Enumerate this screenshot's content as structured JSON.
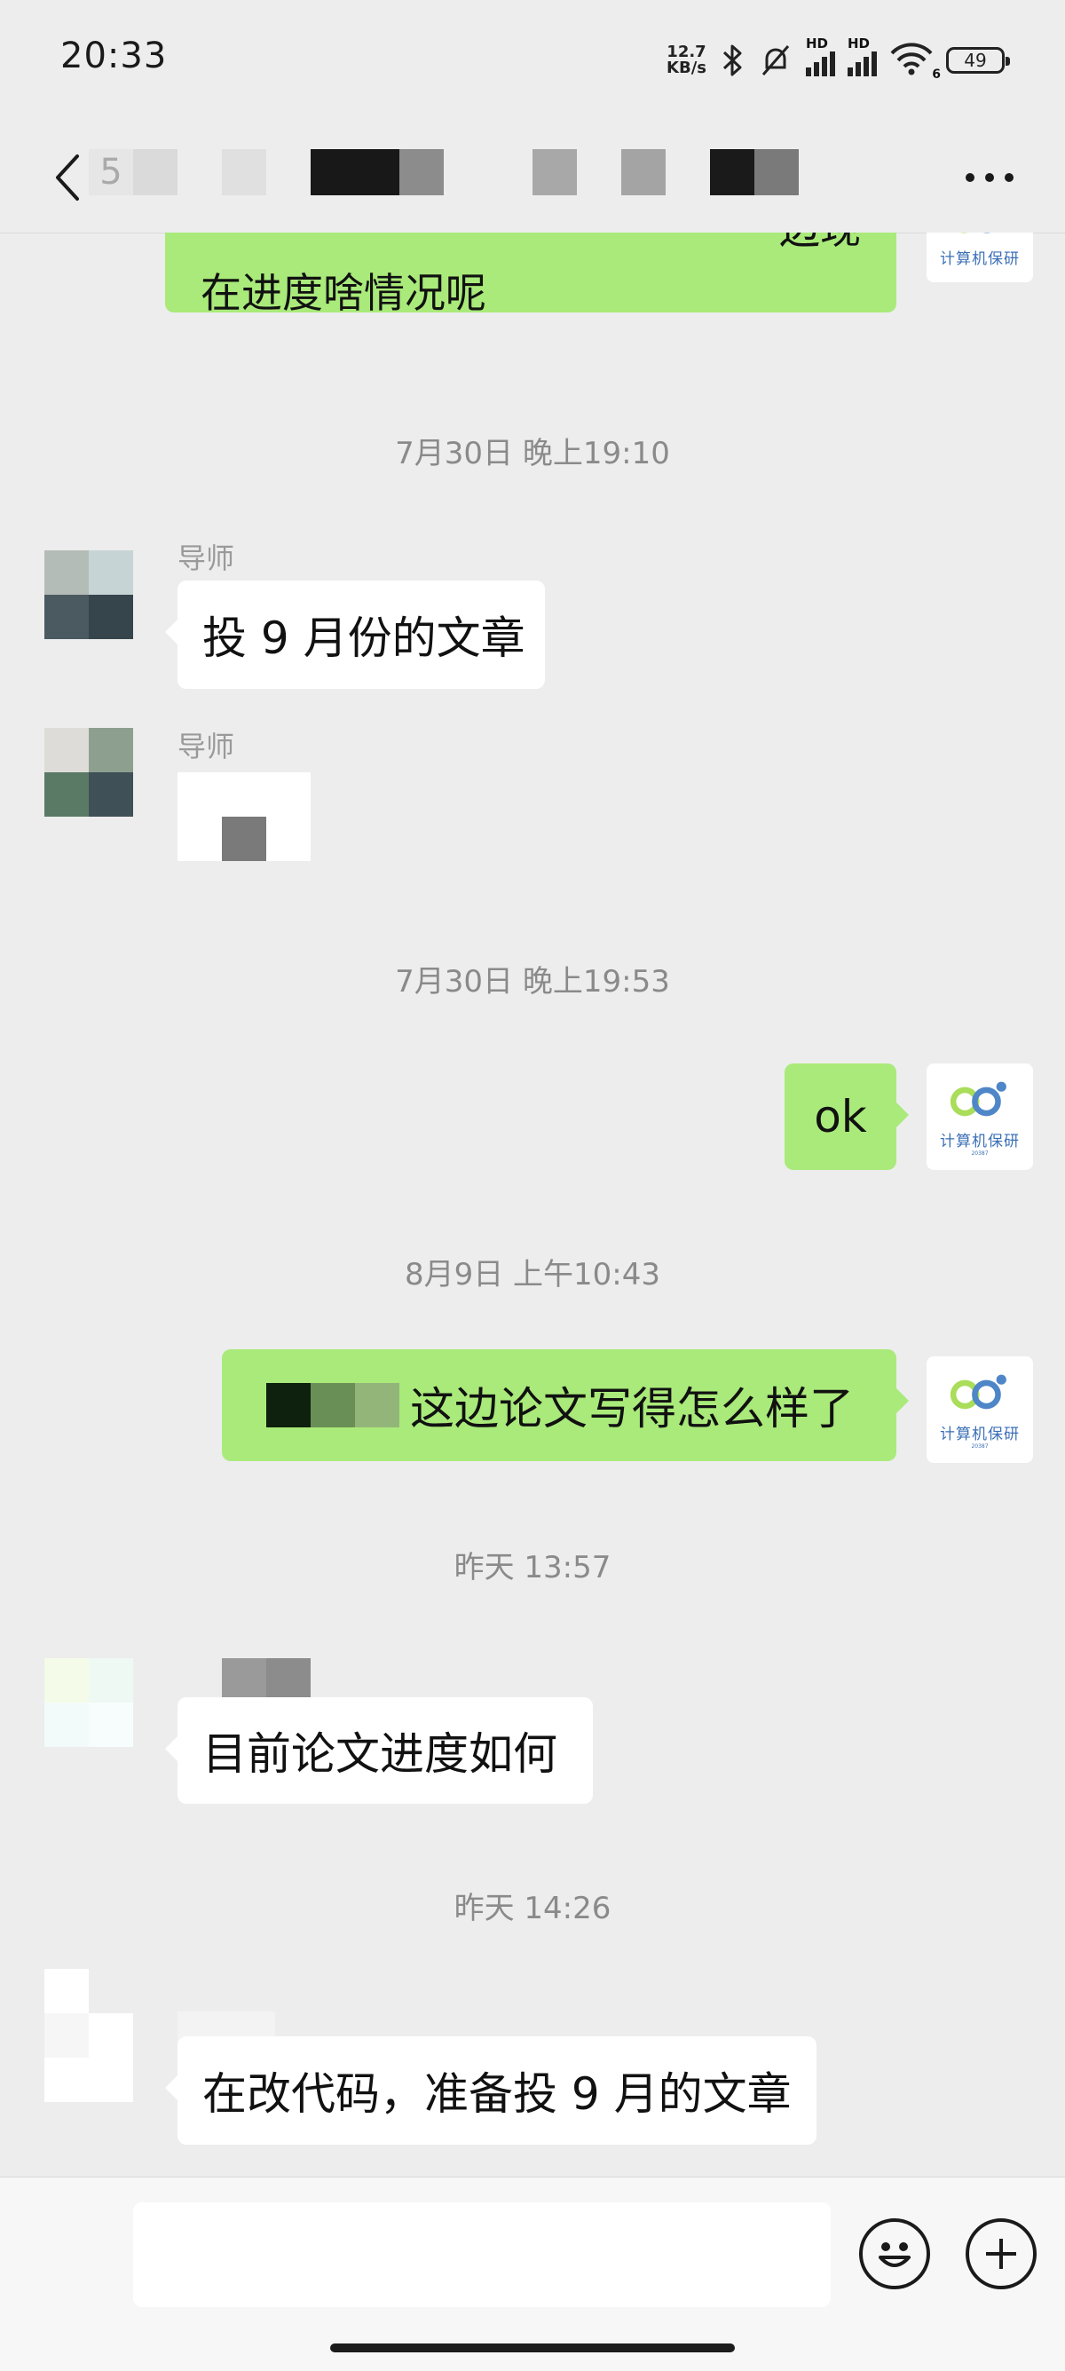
{
  "status_bar": {
    "time": "20:33",
    "net_speed_value": "12.7",
    "net_speed_unit": "KB/s",
    "signal_label_1": "HD",
    "signal_label_2": "HD",
    "wifi_sub": "6",
    "battery": "49"
  },
  "header": {
    "back_icon": "chevron-left-icon",
    "title_prefix": "5",
    "more_icon": "more-dots-icon"
  },
  "messages": {
    "m0": {
      "text": "在进度啥情况呢",
      "partial_top_text": "边现"
    },
    "ts1": "7月30日 晚上19:10",
    "m1": {
      "sender": "导师",
      "text": "投 9 月份的文章"
    },
    "m2": {
      "sender": "导师"
    },
    "ts2": "7月30日 晚上19:53",
    "m3": {
      "text": "ok"
    },
    "ts3": "8月9日 上午10:43",
    "m4": {
      "text": "这边论文写得怎么样了"
    },
    "ts4": "昨天 13:57",
    "m5": {
      "text": "目前论文进度如何"
    },
    "ts5": "昨天 14:26",
    "m6": {
      "text": "在改代码，准备投 9 月的文章"
    }
  },
  "self_avatar": {
    "logo_text": "计算机保研",
    "logo_sub": "20387"
  },
  "input_bar": {
    "emoji_icon": "emoji-smile-icon",
    "plus_icon": "plus-circle-icon"
  },
  "colors": {
    "background": "#ededed",
    "bubble_out": "#a9ea7a",
    "bubble_in": "#ffffff",
    "timestamp": "#8a8a8a"
  }
}
